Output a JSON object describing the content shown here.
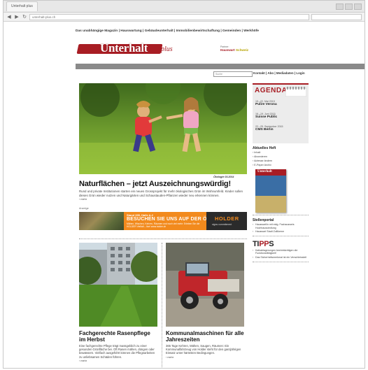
{
  "browser": {
    "tab_label": "Unterhalt plus",
    "url": "unterhalt-plus.ch"
  },
  "site": {
    "topline": "Das unabhängige Magazin | Hauswartung | Gebäudeunterhalt | Immobilienbewirtschaftung | Gemeinden | Werkhöfe",
    "logo_main": "Unterhalt",
    "logo_plus": "plus",
    "partner_small": "Partner:",
    "partner_name": "Hauswart",
    "partner_suffix": "Schweiz"
  },
  "nav": {
    "items": [
      "Aktuell",
      "Tipps",
      "Marktplatz",
      "Agenda",
      "Stellenportal"
    ]
  },
  "search": {
    "placeholder": "Suche"
  },
  "toplinks": "Kontakt  |  Abo  |  Mediadaten  |  Login",
  "hero": {
    "caption": "Ökologie 03.2014",
    "headline": "Naturflächen – jetzt Auszeichnungswürdig!",
    "teaser": "Rund und private Institutionen starten ein neues Grossprojekt für mehr ökologisches Grün im Wohnumfeld. Kinder sollen dieses Grün wieder nutzen und Naturgärten und Schaustauden-Pflanzen wieder neu erkennen können.",
    "more": "mehr"
  },
  "ad": {
    "label": "Anzeige",
    "small": "Stand 335, Halle A.2",
    "main": "BESUCHEN SIE UNS AUF DER ÖGA 2014",
    "sub": "Mähen, Wischen, Kehren, Räumen und noch viel mehr: Erleben Sie die HOLDER Vielfalt – live! www.holder.ch",
    "brand": "HOLDER",
    "brand_sub": "signs commitment"
  },
  "cards": [
    {
      "title": "Fachgerechte Rasenpflege im Herbst",
      "text": "Eine fachgerechte Pflege trägt massgeblich zu einer gesunden Grünfläche bei. Oft Rasen mähen, düngen oder bewässern. Vielfach ausgeführt können die Pflegearbeiten zu unliebsamen Schäden führen.",
      "more": "mehr"
    },
    {
      "title": "Kommunalmaschinen für alle Jahreszeiten",
      "text": "365 Tage Kehren, Mähen, Saugen, Räumen: Ein Kommunalfahrzeug von Holder steht für den ganzjährigen Einsatz unter härtesten Bedingungen.",
      "more": "mehr"
    }
  ],
  "sidebar": {
    "agenda_title": "AGENDA",
    "events": [
      {
        "date": "19.–22. Mai 2015",
        "name": "Pulire Verona"
      },
      {
        "date": "16.–19. Juni 2015",
        "name": "Suisse Public"
      },
      {
        "date": "22.–25. September 2015",
        "name": "CMS Berlin"
      }
    ],
    "issue_heading": "Aktuelles Heft",
    "issue_links": [
      "Inhalt",
      "Abonnieren",
      "Adresse ändern",
      "E-Paper Archiv"
    ],
    "mag_title": "Unterhalt",
    "jobs_heading": "Stellenportal",
    "jobs": [
      "Hauswart/in mit eidg. Fachausweis Hochhaussiedlung",
      "Hauswart Stadt Zollikerne"
    ],
    "tipps_main": "TI",
    "tipps_accent": "PP",
    "tipps_end": "S",
    "tips": [
      "Kalkablagerungen beeinträchtigen die Funktionsfähigkeit!",
      "Das Sicherheitsmerkmal ist ein Verschleissteil"
    ]
  }
}
